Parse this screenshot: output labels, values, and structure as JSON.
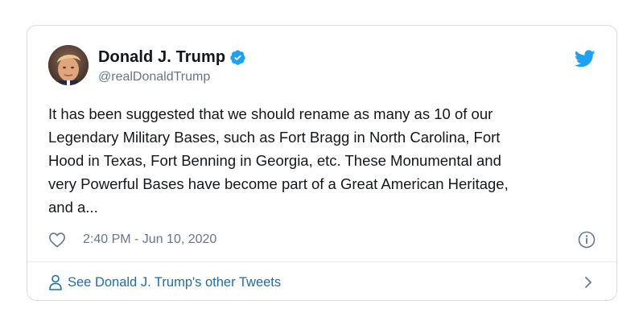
{
  "tweet": {
    "display_name": "Donald J. Trump",
    "handle": "@realDonaldTrump",
    "text": "It has been suggested that we should rename as many as 10 of our\nLegendary Military Bases, such as Fort Bragg in North Carolina, Fort\nHood in Texas, Fort Benning in Georgia, etc. These Monumental and\nvery Powerful Bases have become part of a Great American Heritage,\nand a...",
    "timestamp": "2:40 PM - Jun 10, 2020"
  },
  "footer": {
    "link_label": "See Donald J. Trump's other Tweets"
  },
  "icons": {
    "verified": "verified-badge-icon",
    "brand": "twitter-bird-icon",
    "like": "heart-icon",
    "info": "info-icon",
    "profile": "person-icon",
    "chevron": "chevron-right-icon"
  },
  "colors": {
    "brand_blue": "#1da1f2",
    "link_blue": "#1b6ea8",
    "text": "#14171a",
    "muted": "#657786",
    "border": "#d9dde1"
  }
}
